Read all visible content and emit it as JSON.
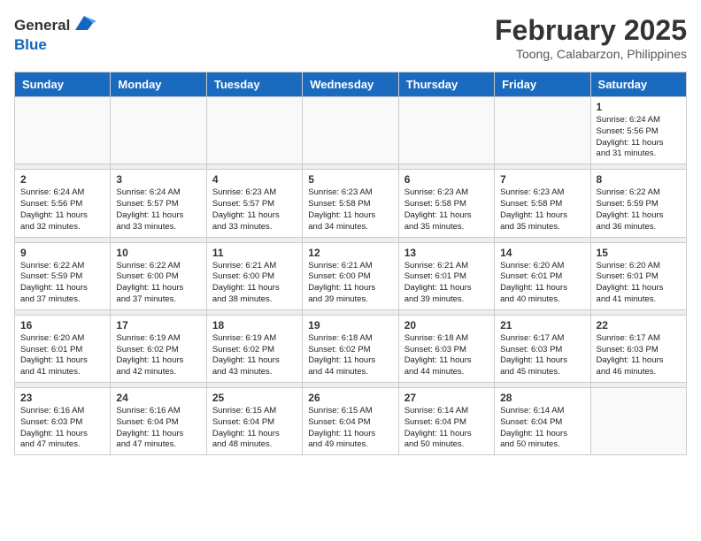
{
  "header": {
    "logo_general": "General",
    "logo_blue": "Blue",
    "month": "February 2025",
    "location": "Toong, Calabarzon, Philippines"
  },
  "weekdays": [
    "Sunday",
    "Monday",
    "Tuesday",
    "Wednesday",
    "Thursday",
    "Friday",
    "Saturday"
  ],
  "weeks": [
    [
      {
        "day": "",
        "info": ""
      },
      {
        "day": "",
        "info": ""
      },
      {
        "day": "",
        "info": ""
      },
      {
        "day": "",
        "info": ""
      },
      {
        "day": "",
        "info": ""
      },
      {
        "day": "",
        "info": ""
      },
      {
        "day": "1",
        "info": "Sunrise: 6:24 AM\nSunset: 5:56 PM\nDaylight: 11 hours\nand 31 minutes."
      }
    ],
    [
      {
        "day": "2",
        "info": "Sunrise: 6:24 AM\nSunset: 5:56 PM\nDaylight: 11 hours\nand 32 minutes."
      },
      {
        "day": "3",
        "info": "Sunrise: 6:24 AM\nSunset: 5:57 PM\nDaylight: 11 hours\nand 33 minutes."
      },
      {
        "day": "4",
        "info": "Sunrise: 6:23 AM\nSunset: 5:57 PM\nDaylight: 11 hours\nand 33 minutes."
      },
      {
        "day": "5",
        "info": "Sunrise: 6:23 AM\nSunset: 5:58 PM\nDaylight: 11 hours\nand 34 minutes."
      },
      {
        "day": "6",
        "info": "Sunrise: 6:23 AM\nSunset: 5:58 PM\nDaylight: 11 hours\nand 35 minutes."
      },
      {
        "day": "7",
        "info": "Sunrise: 6:23 AM\nSunset: 5:58 PM\nDaylight: 11 hours\nand 35 minutes."
      },
      {
        "day": "8",
        "info": "Sunrise: 6:22 AM\nSunset: 5:59 PM\nDaylight: 11 hours\nand 36 minutes."
      }
    ],
    [
      {
        "day": "9",
        "info": "Sunrise: 6:22 AM\nSunset: 5:59 PM\nDaylight: 11 hours\nand 37 minutes."
      },
      {
        "day": "10",
        "info": "Sunrise: 6:22 AM\nSunset: 6:00 PM\nDaylight: 11 hours\nand 37 minutes."
      },
      {
        "day": "11",
        "info": "Sunrise: 6:21 AM\nSunset: 6:00 PM\nDaylight: 11 hours\nand 38 minutes."
      },
      {
        "day": "12",
        "info": "Sunrise: 6:21 AM\nSunset: 6:00 PM\nDaylight: 11 hours\nand 39 minutes."
      },
      {
        "day": "13",
        "info": "Sunrise: 6:21 AM\nSunset: 6:01 PM\nDaylight: 11 hours\nand 39 minutes."
      },
      {
        "day": "14",
        "info": "Sunrise: 6:20 AM\nSunset: 6:01 PM\nDaylight: 11 hours\nand 40 minutes."
      },
      {
        "day": "15",
        "info": "Sunrise: 6:20 AM\nSunset: 6:01 PM\nDaylight: 11 hours\nand 41 minutes."
      }
    ],
    [
      {
        "day": "16",
        "info": "Sunrise: 6:20 AM\nSunset: 6:01 PM\nDaylight: 11 hours\nand 41 minutes."
      },
      {
        "day": "17",
        "info": "Sunrise: 6:19 AM\nSunset: 6:02 PM\nDaylight: 11 hours\nand 42 minutes."
      },
      {
        "day": "18",
        "info": "Sunrise: 6:19 AM\nSunset: 6:02 PM\nDaylight: 11 hours\nand 43 minutes."
      },
      {
        "day": "19",
        "info": "Sunrise: 6:18 AM\nSunset: 6:02 PM\nDaylight: 11 hours\nand 44 minutes."
      },
      {
        "day": "20",
        "info": "Sunrise: 6:18 AM\nSunset: 6:03 PM\nDaylight: 11 hours\nand 44 minutes."
      },
      {
        "day": "21",
        "info": "Sunrise: 6:17 AM\nSunset: 6:03 PM\nDaylight: 11 hours\nand 45 minutes."
      },
      {
        "day": "22",
        "info": "Sunrise: 6:17 AM\nSunset: 6:03 PM\nDaylight: 11 hours\nand 46 minutes."
      }
    ],
    [
      {
        "day": "23",
        "info": "Sunrise: 6:16 AM\nSunset: 6:03 PM\nDaylight: 11 hours\nand 47 minutes."
      },
      {
        "day": "24",
        "info": "Sunrise: 6:16 AM\nSunset: 6:04 PM\nDaylight: 11 hours\nand 47 minutes."
      },
      {
        "day": "25",
        "info": "Sunrise: 6:15 AM\nSunset: 6:04 PM\nDaylight: 11 hours\nand 48 minutes."
      },
      {
        "day": "26",
        "info": "Sunrise: 6:15 AM\nSunset: 6:04 PM\nDaylight: 11 hours\nand 49 minutes."
      },
      {
        "day": "27",
        "info": "Sunrise: 6:14 AM\nSunset: 6:04 PM\nDaylight: 11 hours\nand 50 minutes."
      },
      {
        "day": "28",
        "info": "Sunrise: 6:14 AM\nSunset: 6:04 PM\nDaylight: 11 hours\nand 50 minutes."
      },
      {
        "day": "",
        "info": ""
      }
    ]
  ]
}
